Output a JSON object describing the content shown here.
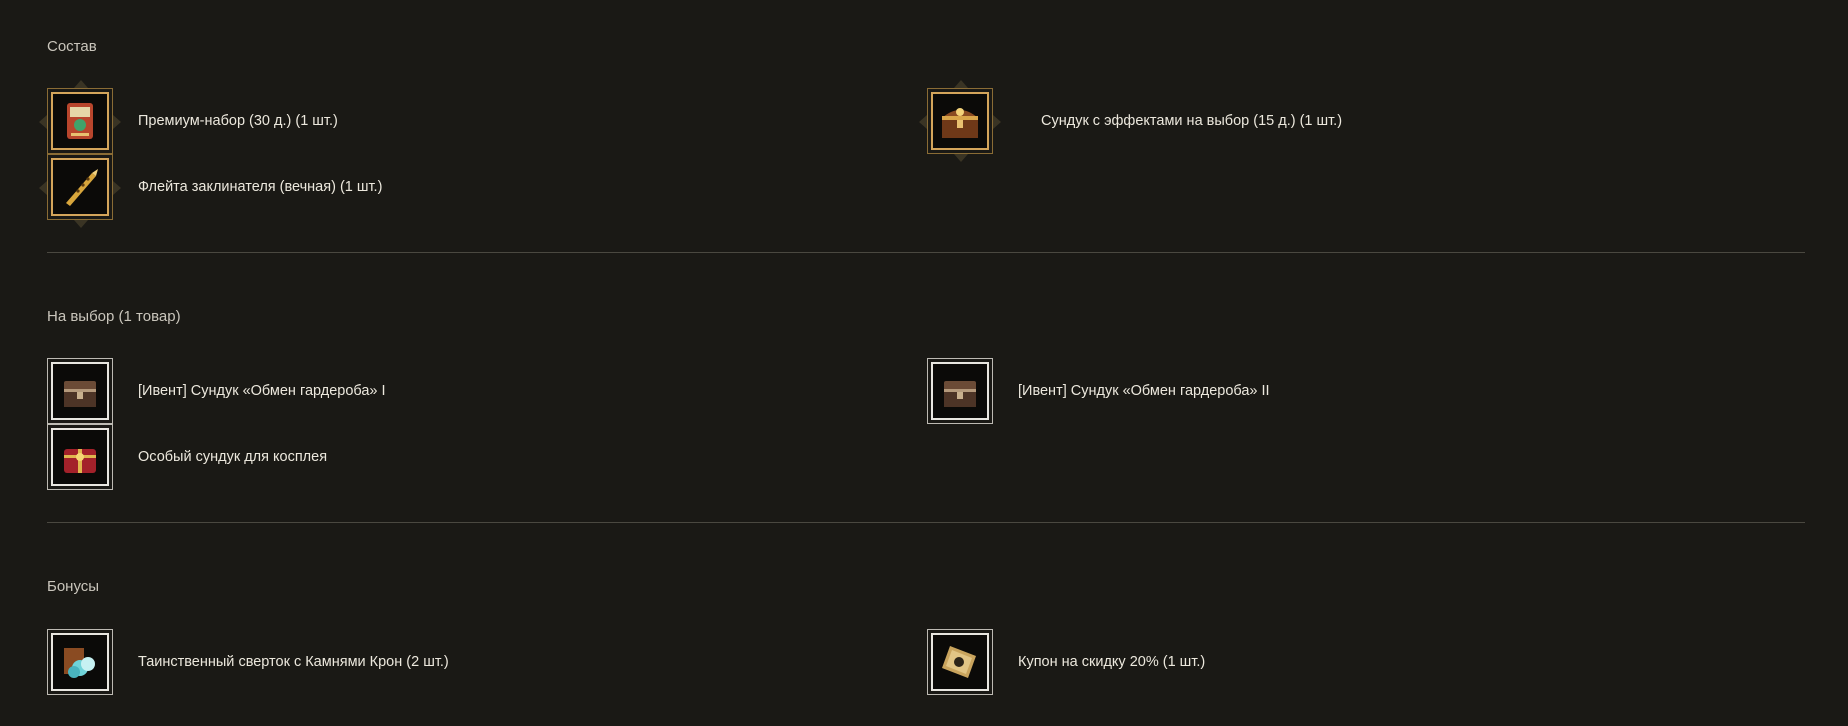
{
  "sections": {
    "composition": {
      "title": "Состав",
      "items": [
        {
          "label": "Премиум-набор (30 д.) (1 шт.)",
          "icon": "premium-pack-icon"
        },
        {
          "label": "Сундук с эффектами на выбор (15 д.) (1 шт.)",
          "icon": "effects-chest-icon"
        },
        {
          "label": "Флейта заклинателя (вечная) (1 шт.)",
          "icon": "flute-icon"
        }
      ]
    },
    "choice": {
      "title": "На выбор (1 товар)",
      "items": [
        {
          "label": "[Ивент] Сундук «Обмен гардероба» I",
          "icon": "wardrobe-chest-icon"
        },
        {
          "label": "[Ивент] Сундук «Обмен гардероба» II",
          "icon": "wardrobe-chest-icon"
        },
        {
          "label": "Особый сундук для косплея",
          "icon": "cosplay-chest-icon"
        }
      ]
    },
    "bonuses": {
      "title": "Бонусы",
      "items": [
        {
          "label": "Таинственный сверток с Камнями Крон (2 шт.)",
          "icon": "crown-stones-bundle-icon"
        },
        {
          "label": "Купон на скидку 20% (1 шт.)",
          "icon": "discount-coupon-icon"
        }
      ]
    }
  },
  "colors": {
    "background": "#1a1915",
    "gold_frame": "#d4a55b",
    "white_frame": "#e8e6e0",
    "divider": "#4a4840"
  }
}
